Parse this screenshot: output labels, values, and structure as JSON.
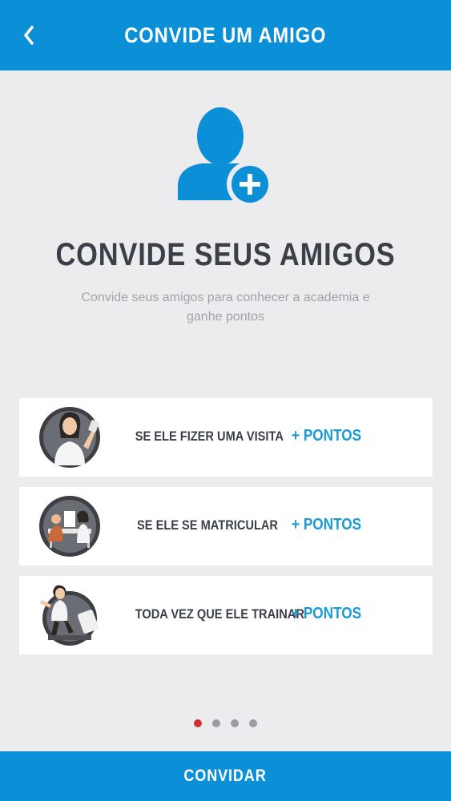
{
  "colors": {
    "primary": "#0b8fd6",
    "background": "#ececee",
    "title_text": "#3b3f48",
    "subtitle_text": "#a1a3a8",
    "points_text": "#1a9ad6",
    "dot_active": "#cc3233",
    "dot_inactive": "#9a9ca2"
  },
  "header": {
    "back_icon": "chevron-left-icon",
    "title": "CONVIDE UM AMIGO"
  },
  "hero": {
    "icon": "add-user-icon",
    "title": "CONVIDE SEUS AMIGOS",
    "subtitle": "Convide seus amigos para conhecer a academia e ganhe pontos"
  },
  "cards": [
    {
      "label": "SE ELE FIZER UMA VISITA",
      "points": "+ PONTOS",
      "icon": "visit-avatar-icon"
    },
    {
      "label": "SE ELE SE MATRICULAR",
      "points": "+ PONTOS",
      "icon": "enroll-avatar-icon"
    },
    {
      "label": "TODA VEZ QUE ELE TRAINAR",
      "points": "+ PONTOS",
      "icon": "train-avatar-icon"
    }
  ],
  "pagination": {
    "total": 4,
    "active": 1
  },
  "footer": {
    "button_label": "CONVIDAR"
  }
}
